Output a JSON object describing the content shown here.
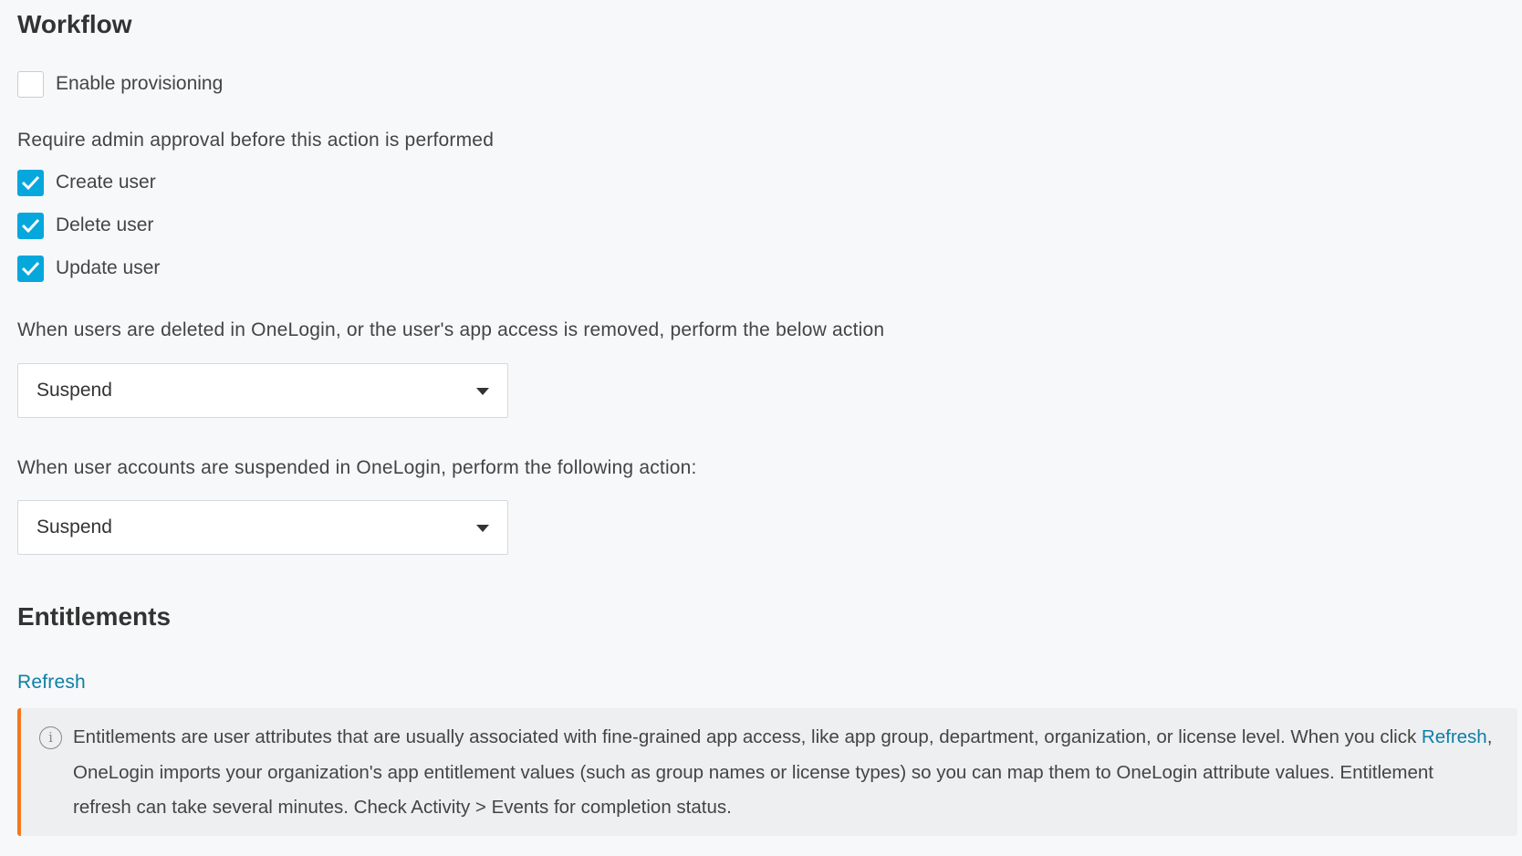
{
  "workflow": {
    "title": "Workflow",
    "enable_provisioning": {
      "label": "Enable provisioning",
      "checked": false
    },
    "approval_heading": "Require admin approval before this action is performed",
    "approvals": [
      {
        "label": "Create user",
        "checked": true
      },
      {
        "label": "Delete user",
        "checked": true
      },
      {
        "label": "Update user",
        "checked": true
      }
    ],
    "deleted_prompt": "When users are deleted in OneLogin, or the user's app access is removed, perform the below action",
    "deleted_action": "Suspend",
    "suspended_prompt": "When user accounts are suspended in OneLogin, perform the following action:",
    "suspended_action": "Suspend"
  },
  "entitlements": {
    "title": "Entitlements",
    "refresh_label": "Refresh",
    "info_before": "Entitlements are user attributes that are usually associated with fine-grained app access, like app group, department, organization, or license level. When you click ",
    "info_link": "Refresh",
    "info_after": ", OneLogin imports your organization's app entitlement values (such as group names or license types) so you can map them to OneLogin attribute values. Entitlement refresh can take several minutes. Check Activity > Events for completion status."
  },
  "colors": {
    "accent": "#06a7dc",
    "link": "#0d7fa6",
    "warning_border": "#f2781e"
  }
}
